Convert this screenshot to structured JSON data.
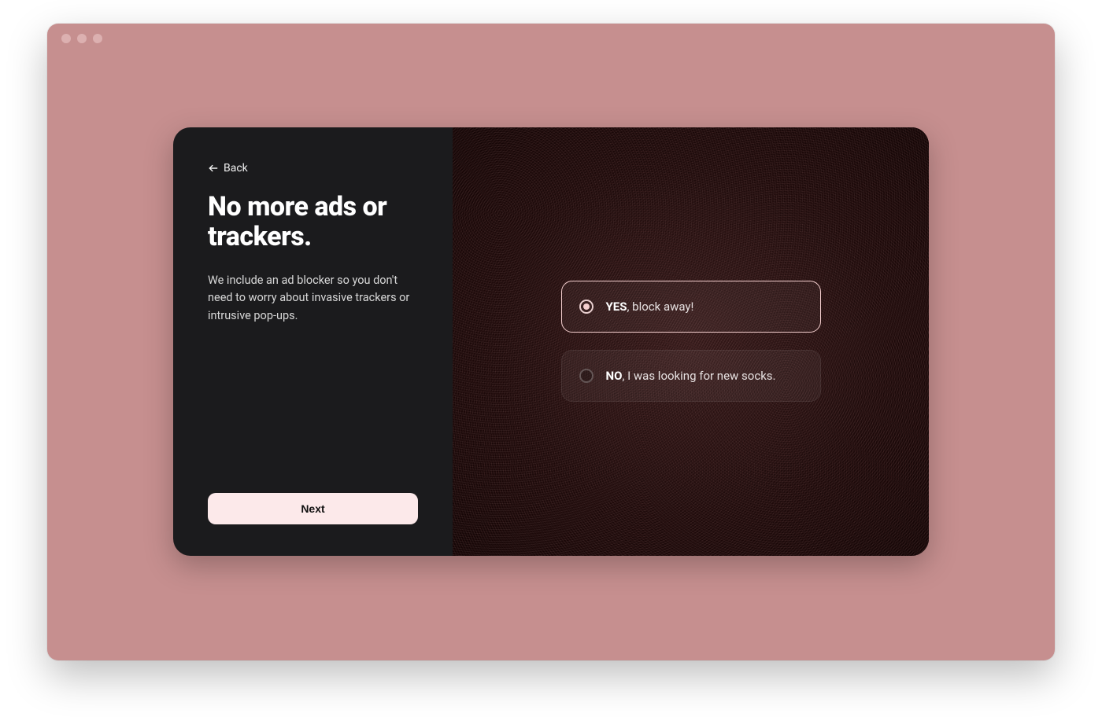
{
  "window": {
    "back_label": "Back",
    "title": "No more ads or trackers.",
    "description": "We include an ad blocker so you don't need to worry about invasive trackers or intrusive pop-ups.",
    "next_label": "Next"
  },
  "options": [
    {
      "strong": "YES",
      "rest": ", block away!",
      "selected": true
    },
    {
      "strong": "NO",
      "rest": ", I was looking for new socks.",
      "selected": false
    }
  ]
}
